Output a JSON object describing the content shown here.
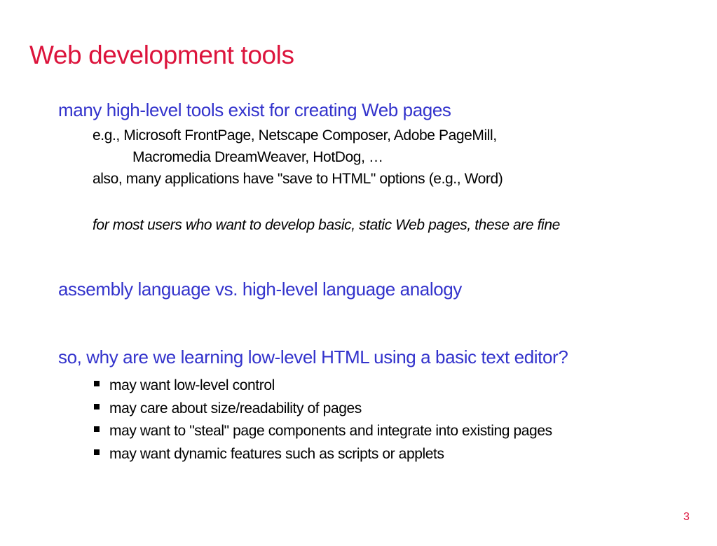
{
  "slide": {
    "title": "Web development tools",
    "heading1": "many high-level tools exist for creating Web pages",
    "line1": "e.g., Microsoft FrontPage, Netscape Composer, Adobe PageMill,",
    "line2": "Macromedia DreamWeaver, HotDog, …",
    "line3": "also, many applications have \"save to HTML\" options (e.g., Word)",
    "line4": "for most users who want to develop basic, static Web pages, these are fine",
    "heading2": "assembly language vs. high-level language analogy",
    "heading3": "so, why are we learning low-level HTML using a basic text editor?",
    "bullets": [
      "may want low-level control",
      "may care about size/readability of pages",
      "may want to \"steal\" page components and integrate into existing pages",
      "may want dynamic features such as scripts or applets"
    ],
    "page_number": "3"
  },
  "colors": {
    "title": "#dc143c",
    "heading": "#3333cc",
    "body": "#000000"
  }
}
